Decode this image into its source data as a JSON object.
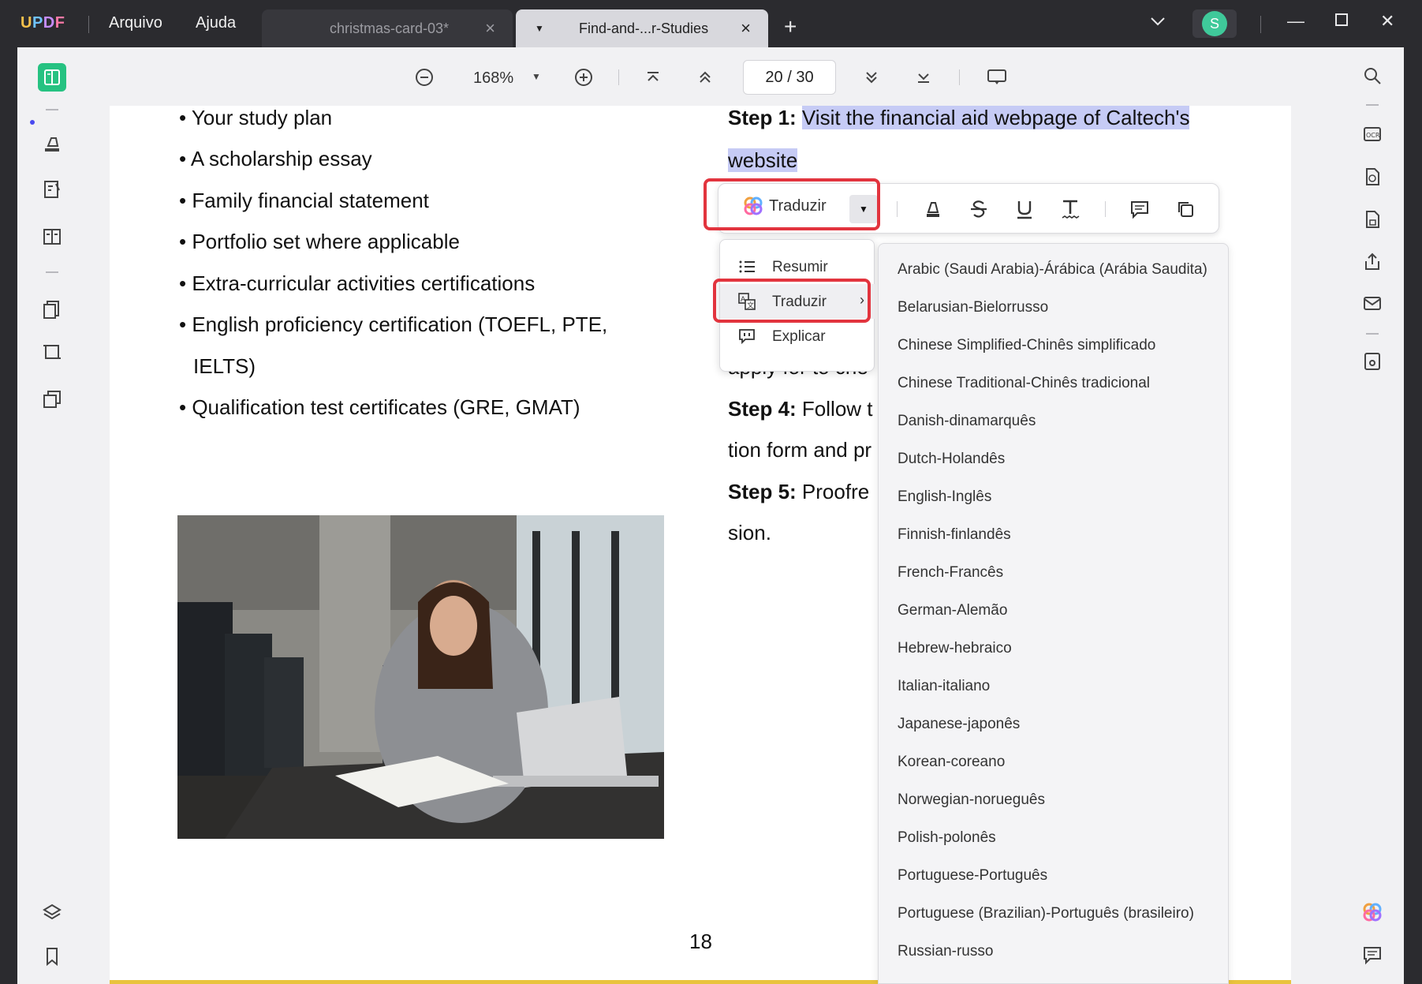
{
  "app": {
    "logo": {
      "u": "U",
      "p": "P",
      "d": "D",
      "f": "F"
    },
    "menu": {
      "file": "Arquivo",
      "help": "Ajuda"
    },
    "tabs": [
      {
        "label": "christmas-card-03*",
        "active": false
      },
      {
        "label": "Find-and-...r-Studies",
        "active": true
      }
    ],
    "user_initial": "S"
  },
  "toolbar": {
    "zoom": "168%",
    "page_current": "20",
    "page_separator": "/",
    "page_total": "30"
  },
  "document": {
    "bullets": [
      "• Your study plan",
      "• A scholarship essay",
      "• Family financial statement",
      "• Portfolio set where applicable",
      "• Extra-curricular activities certifications",
      "• English proficiency certification (TOEFL, PTE,",
      "IELTS)",
      "• Qualification test certificates (GRE, GMAT)"
    ],
    "step1_label": "Step 1:",
    "step1_text": "Visit the financial aid webpage of Caltech's",
    "step1_text2": "website",
    "line_apply": "apply for to che",
    "step4_label": "Step 4:",
    "step4_text": "Follow t",
    "line_tion": "tion form and pr",
    "step5_label": "Step 5:",
    "step5_text": "Proofre",
    "line_sion": "sion.",
    "page_number": "18"
  },
  "floatbar": {
    "translate_label": "Traduzir"
  },
  "ai_menu": {
    "items": [
      {
        "label": "Resumir",
        "icon": "list-icon"
      },
      {
        "label": "Traduzir",
        "icon": "translate-icon"
      },
      {
        "label": "Explicar",
        "icon": "explain-icon"
      }
    ]
  },
  "languages": [
    "Arabic (Saudi Arabia)-Árábica (Arábia Saudita)",
    "Belarusian-Bielorrusso",
    "Chinese Simplified-Chinês simplificado",
    "Chinese Traditional-Chinês tradicional",
    "Danish-dinamarquês",
    "Dutch-Holandês",
    "English-Inglês",
    "Finnish-finlandês",
    "French-Francês",
    "German-Alemão",
    "Hebrew-hebraico",
    "Italian-italiano",
    "Japanese-japonês",
    "Korean-coreano",
    "Norwegian-norueguês",
    "Polish-polonês",
    "Portuguese-Português",
    "Portuguese (Brazilian)-Português (brasileiro)",
    "Russian-russo"
  ],
  "colors": {
    "accent": "#26c281",
    "highlight": "#c6cbf5",
    "callout": "#e2343e",
    "titlebar": "#2b2b2f"
  }
}
